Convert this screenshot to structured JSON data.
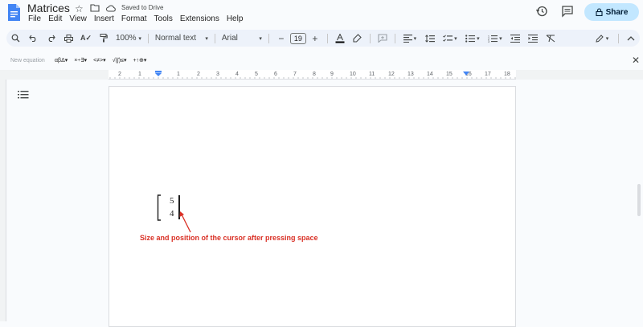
{
  "app": {
    "doc_title": "Matrices",
    "saved_status": "Saved to Drive",
    "share_label": "Share"
  },
  "menu": [
    "File",
    "Edit",
    "View",
    "Insert",
    "Format",
    "Tools",
    "Extensions",
    "Help"
  ],
  "toolbar": {
    "zoom": "100%",
    "style": "Normal text",
    "font": "Arial",
    "font_size": "19"
  },
  "equation_bar": {
    "new_equation": "New equation",
    "menus": [
      "αβΔ",
      "×÷∃",
      "<≠>",
      "√(∫)≤",
      "+↑⊕"
    ]
  },
  "ruler": {
    "ticks": [
      "2",
      "1",
      "1",
      "2",
      "3",
      "4",
      "5",
      "6",
      "7",
      "8",
      "9",
      "10",
      "11",
      "12",
      "13",
      "14",
      "15",
      "16",
      "17",
      "18"
    ]
  },
  "document": {
    "matrix": [
      "5",
      "4"
    ],
    "annotation": "Size and position of the cursor after pressing space",
    "annotation_color": "#d93025"
  },
  "colors": {
    "accent": "#c2e7ff",
    "doc_blue": "#4285f4"
  }
}
